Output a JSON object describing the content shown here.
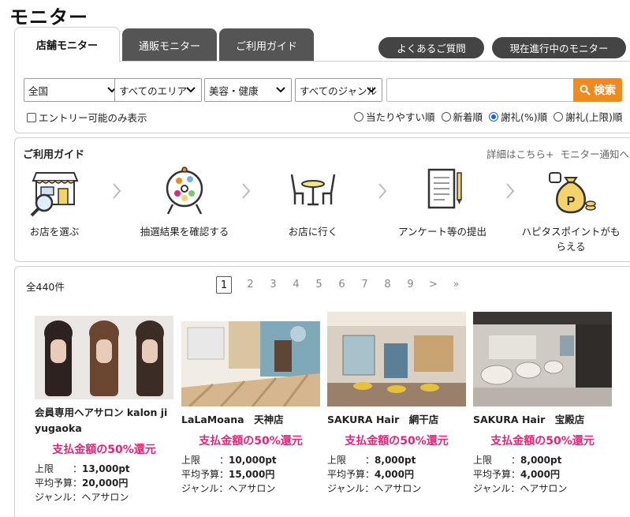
{
  "page": {
    "title": "モニター"
  },
  "tabs": [
    {
      "label": "店舗モニター",
      "active": true
    },
    {
      "label": "通販モニター",
      "active": false
    },
    {
      "label": "ご利用ガイド",
      "active": false
    }
  ],
  "header_buttons": {
    "faq": "よくあるご質問",
    "current": "現在進行中のモニター"
  },
  "search": {
    "selects": [
      "全国",
      "すべてのエリア",
      "美容・健康",
      "すべてのジャンル"
    ],
    "input_value": "",
    "button_label": "検索",
    "entry_only_label": "エントリー可能のみ表示",
    "sort_options": [
      {
        "label": "当たりやすい順",
        "checked": false
      },
      {
        "label": "新着順",
        "checked": false
      },
      {
        "label": "謝礼(%)順",
        "checked": true
      },
      {
        "label": "謝礼(上限)順",
        "checked": false
      }
    ]
  },
  "guide": {
    "title": "ご利用ガイド",
    "link_details": "詳細はこちら+",
    "link_notify": "モニター通知へ",
    "steps": [
      {
        "label": "お店を選ぶ",
        "icon": "store-search-icon"
      },
      {
        "label": "抽選結果を確認する",
        "icon": "lottery-drum-icon"
      },
      {
        "label": "お店に行く",
        "icon": "table-chairs-icon"
      },
      {
        "label": "アンケート等の提出",
        "icon": "document-pen-icon"
      },
      {
        "label": "ハピタスポイントがもらえる",
        "icon": "money-bag-icon"
      }
    ]
  },
  "results": {
    "count": "全440件",
    "pages": [
      "1",
      "2",
      "3",
      "4",
      "5",
      "6",
      "7",
      "8",
      "9",
      ">",
      "»"
    ],
    "current_page": 1,
    "cards": [
      {
        "name": "会員専用ヘアサロン kalon jiyugaoka",
        "rebate": "支払金額の50%還元",
        "upper_label": "上限",
        "upper": "13,000pt",
        "budget_label": "平均予算",
        "budget": "20,000円",
        "genre_label": "ジャンル",
        "genre": "ヘアサロン"
      },
      {
        "name": "LaLaMoana　天神店",
        "rebate": "支払金額の50%還元",
        "upper_label": "上限",
        "upper": "10,000pt",
        "budget_label": "平均予算",
        "budget": "15,000円",
        "genre_label": "ジャンル",
        "genre": "ヘアサロン"
      },
      {
        "name": "SAKURA Hair　網干店",
        "rebate": "支払金額の50%還元",
        "upper_label": "上限",
        "upper": "8,000pt",
        "budget_label": "平均予算",
        "budget": "4,000円",
        "genre_label": "ジャンル",
        "genre": "ヘアサロン"
      },
      {
        "name": "SAKURA Hair　宝殿店",
        "rebate": "支払金額の50%還元",
        "upper_label": "上限",
        "upper": "8,000pt",
        "budget_label": "平均予算",
        "budget": "4,000円",
        "genre_label": "ジャンル",
        "genre": "ヘアサロン"
      }
    ]
  },
  "colors": {
    "accent_orange": "#f08a1c",
    "rebate_pink": "#e0257a",
    "tab_dark": "#555555",
    "radio_blue": "#1a62d9"
  }
}
